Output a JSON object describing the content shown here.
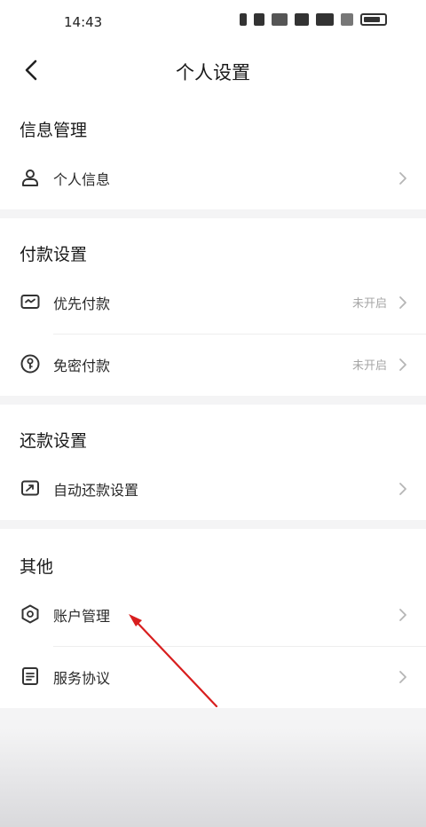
{
  "status_bar": {
    "time": "14:43"
  },
  "header": {
    "title": "个人设置",
    "back_icon": "chevron-left-icon"
  },
  "sections": [
    {
      "title": "信息管理",
      "items": [
        {
          "label": "个人信息",
          "icon": "person-icon",
          "status": ""
        }
      ]
    },
    {
      "title": "付款设置",
      "items": [
        {
          "label": "优先付款",
          "icon": "card-icon",
          "status": "未开启"
        },
        {
          "label": "免密付款",
          "icon": "key-icon",
          "status": "未开启"
        }
      ]
    },
    {
      "title": "还款设置",
      "items": [
        {
          "label": "自动还款设置",
          "icon": "repay-icon",
          "status": ""
        }
      ]
    },
    {
      "title": "其他",
      "items": [
        {
          "label": "账户管理",
          "icon": "shield-icon",
          "status": ""
        },
        {
          "label": "服务协议",
          "icon": "document-icon",
          "status": ""
        }
      ]
    }
  ],
  "colors": {
    "annotation_arrow": "#d81e1e",
    "background": "#f4f4f5"
  }
}
